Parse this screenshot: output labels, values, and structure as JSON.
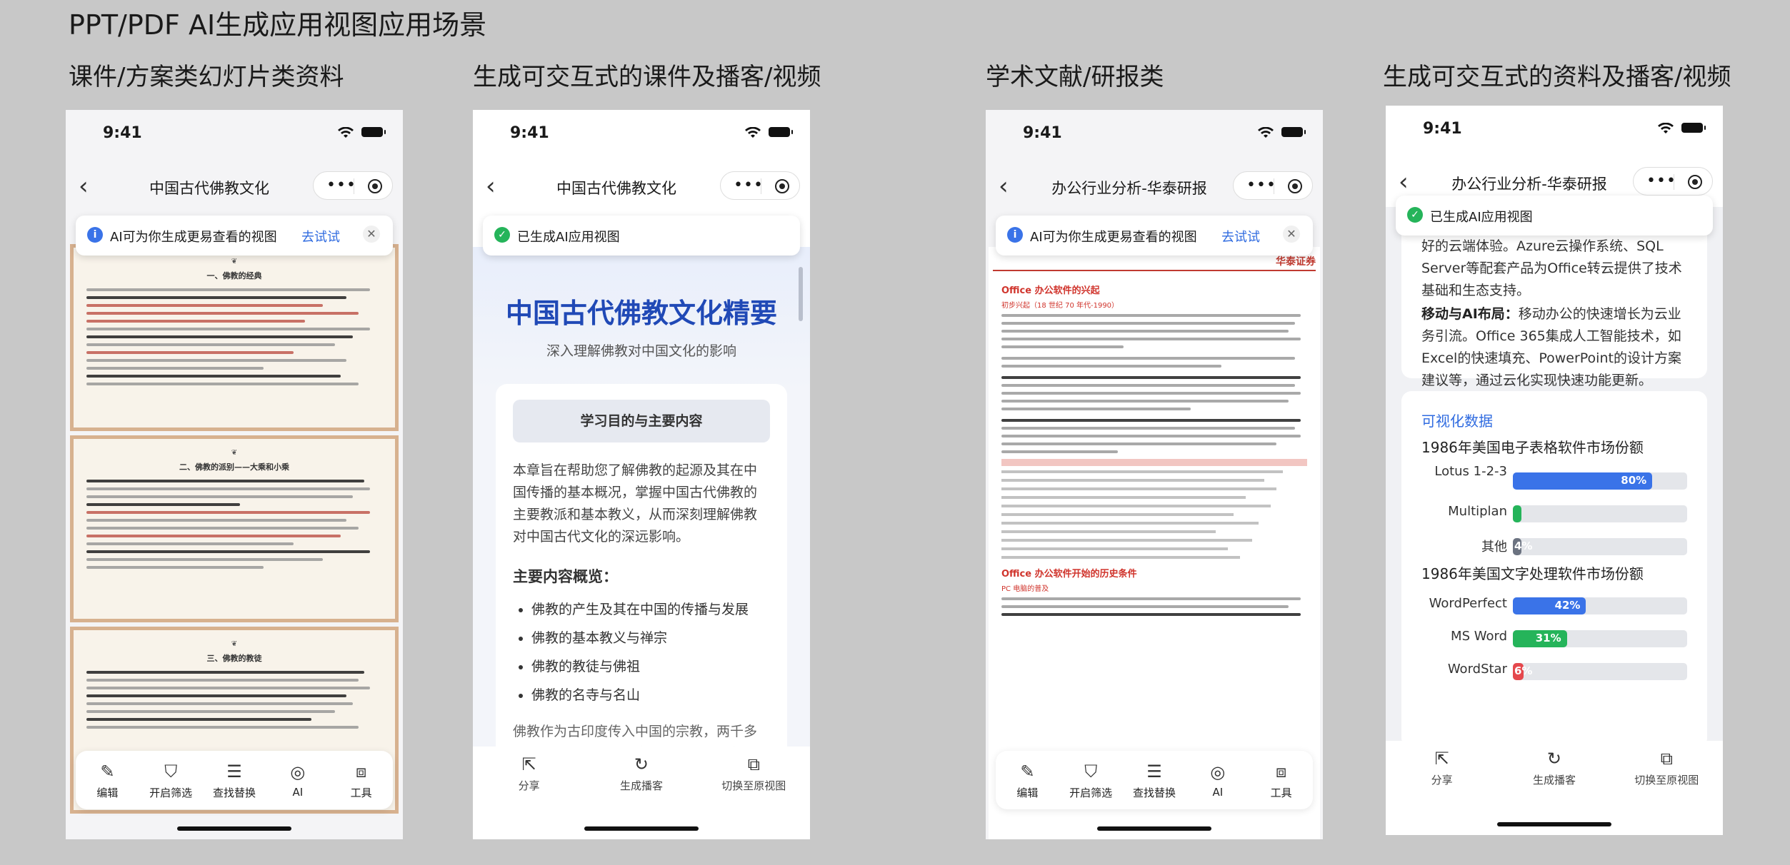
{
  "page_title": "PPT/PDF AI生成应用视图应用场景",
  "columns": [
    "课件/方案类幻灯片类资料",
    "生成可交互式的课件及播客/视频",
    "学术文献/研报类",
    "生成可交互式的资料及播客/视频"
  ],
  "status_time": "9:41",
  "phones": {
    "p1": {
      "nav_title": "中国古代佛教文化",
      "toast": {
        "msg": "AI可为你生成更易查看的视图",
        "action": "去试试"
      },
      "scan_titles": [
        "一、佛教的经典",
        "二、佛教的派别——大乘和小乘",
        "三、佛教的教徒"
      ],
      "tools": [
        "编辑",
        "开启筛选",
        "查找替换",
        "AI",
        "工具"
      ]
    },
    "p2": {
      "nav_title": "中国古代佛教文化",
      "toast": {
        "msg": "已生成AI应用视图"
      },
      "heading": "中国古代佛教文化精要",
      "subheading": "深入理解佛教对中国文化的影响",
      "card_title": "学习目的与主要内容",
      "intro": "本章旨在帮助您了解佛教的起源及其在中国传播的基本概况，掌握中国古代佛教的主要教派和基本教义，从而深刻理解佛教对中国古代文化的深远影响。",
      "overview_title": "主要内容概览：",
      "overview_items": [
        "佛教的产生及其在中国的传播与发展",
        "佛教的基本教义与禅宗",
        "佛教的教徒与佛祖",
        "佛教的名寺与名山"
      ],
      "tail": "佛教作为古印度传入中国的宗教，两千多年来已成为中国传统文化的重要组成部分，其影响渗透",
      "tools": [
        "分享",
        "生成播客",
        "切换至原视图"
      ]
    },
    "p3": {
      "nav_title": "办公行业分析-华泰研报",
      "toast": {
        "msg": "AI可为你生成更易查看的视图",
        "action": "去试试"
      },
      "doc_header_right": "华泰证券",
      "doc_headings": [
        "Office 办公软件的兴起",
        "Office 办公软件开始的历史条件"
      ],
      "doc_subheadings": [
        "初步兴起（18 世纪 70 年代-1990）",
        "PC 电脑的普及"
      ],
      "tools": [
        "编辑",
        "开启筛选",
        "查找替换",
        "AI",
        "工具"
      ]
    },
    "p4": {
      "nav_title": "办公行业分析-华泰研报",
      "toast": {
        "msg": "已生成AI应用视图"
      },
      "text_top": "好的云端体验。Azure云操作系统、SQL Server等配套产品为Office转云提供了技术基础和生态支持。",
      "ai_label": "移动与AI布局：",
      "ai_text": "移动办公的快速增长为云业务引流。Office 365集成人工智能技术，如Excel的快速填充、PowerPoint的设计方案建议等，通过云化实现快速功能更新。",
      "viz_label": "可视化数据",
      "tools": [
        "分享",
        "生成播客",
        "切换至原视图"
      ]
    }
  },
  "chart_data": [
    {
      "type": "bar",
      "title": "1986年美国电子表格软件市场份额",
      "categories": [
        "Lotus 1-2-3",
        "Multiplan",
        "其他"
      ],
      "values": [
        80,
        2,
        4
      ],
      "labels": [
        "80%",
        "",
        "4%"
      ],
      "unit": "%",
      "ylim": [
        0,
        100
      ],
      "colors": [
        "#3a73e8",
        "#25b45a",
        "#6b7280"
      ]
    },
    {
      "type": "bar",
      "title": "1986年美国文字处理软件市场份额",
      "categories": [
        "WordPerfect",
        "MS Word",
        "WordStar"
      ],
      "values": [
        42,
        31,
        6
      ],
      "labels": [
        "42%",
        "31%",
        "6%"
      ],
      "unit": "%",
      "ylim": [
        0,
        100
      ],
      "colors": [
        "#3a73e8",
        "#25b45a",
        "#e5484d"
      ]
    }
  ]
}
